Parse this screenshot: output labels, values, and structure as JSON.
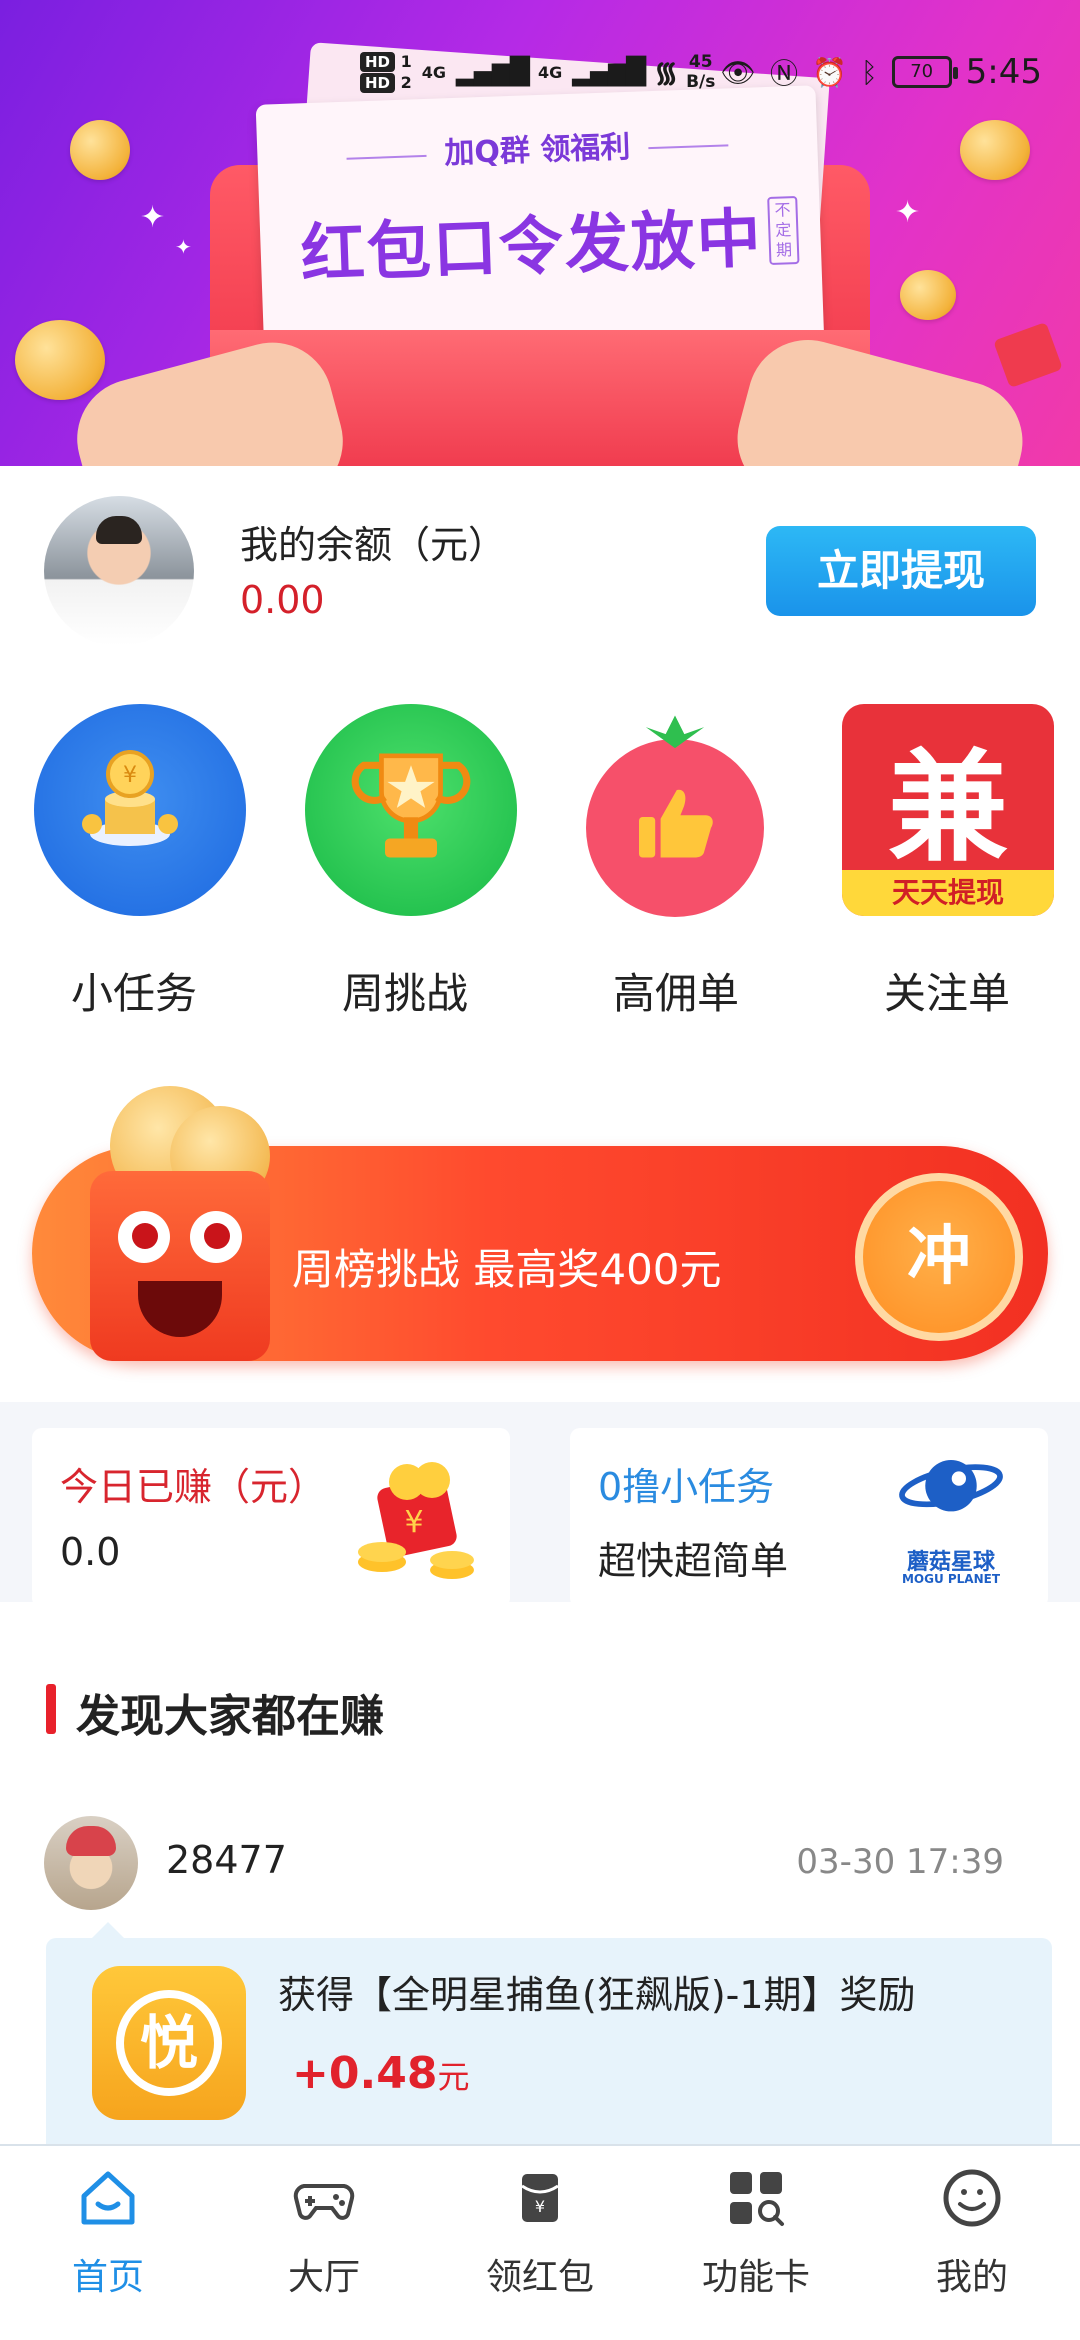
{
  "status_bar": {
    "hd1": "HD",
    "hd1_num": "1",
    "hd2": "HD",
    "hd2_num": "2",
    "sig1": "4G",
    "sig2": "4G",
    "speed_value": "45",
    "speed_unit": "B/s",
    "battery": "70",
    "time": "5:45"
  },
  "banner": {
    "subtitle": "加Q群 领福利",
    "title": "红包口令发放中",
    "tag": "不定期"
  },
  "balance": {
    "label": "我的余额（元）",
    "value": "0.00",
    "withdraw_label": "立即提现"
  },
  "menu": {
    "items": [
      {
        "label": "小任务",
        "icon": "coin-stack-icon"
      },
      {
        "label": "周挑战",
        "icon": "trophy-icon"
      },
      {
        "label": "高佣单",
        "icon": "thumbs-up-icon"
      },
      {
        "label": "关注单",
        "icon": "jian-app-icon"
      }
    ],
    "jian_char": "兼",
    "jian_strip": "天天提现"
  },
  "promo": {
    "text": "周榜挑战  最高奖400元",
    "button_label": "冲"
  },
  "cards": {
    "today": {
      "title": "今日已赚（元）",
      "value": "0.0"
    },
    "mini_task": {
      "title": "0撸小任务",
      "subtitle": "超快超简单",
      "logo_text": "蘑菇星球",
      "logo_sub": "MOGU PLANET"
    }
  },
  "feed": {
    "section_title": "发现大家都在赚",
    "entries": [
      {
        "user": "28477",
        "time": "03-30 17:39",
        "text": "获得【全明星捕鱼(狂飙版)-1期】奖励",
        "reward": "+0.48",
        "unit": "元",
        "game_icon_char": "悦"
      }
    ]
  },
  "bottom_nav": {
    "items": [
      {
        "label": "首页",
        "icon": "home-icon",
        "active": true
      },
      {
        "label": "大厅",
        "icon": "gamepad-icon",
        "active": false
      },
      {
        "label": "领红包",
        "icon": "red-envelope-icon",
        "active": false
      },
      {
        "label": "功能卡",
        "icon": "grid-search-icon",
        "active": false
      },
      {
        "label": "我的",
        "icon": "smiley-icon",
        "active": false
      }
    ]
  },
  "colors": {
    "accent_blue": "#1f8fe6",
    "price_red": "#d4202a",
    "promo_orange": "#ff4a2e"
  }
}
